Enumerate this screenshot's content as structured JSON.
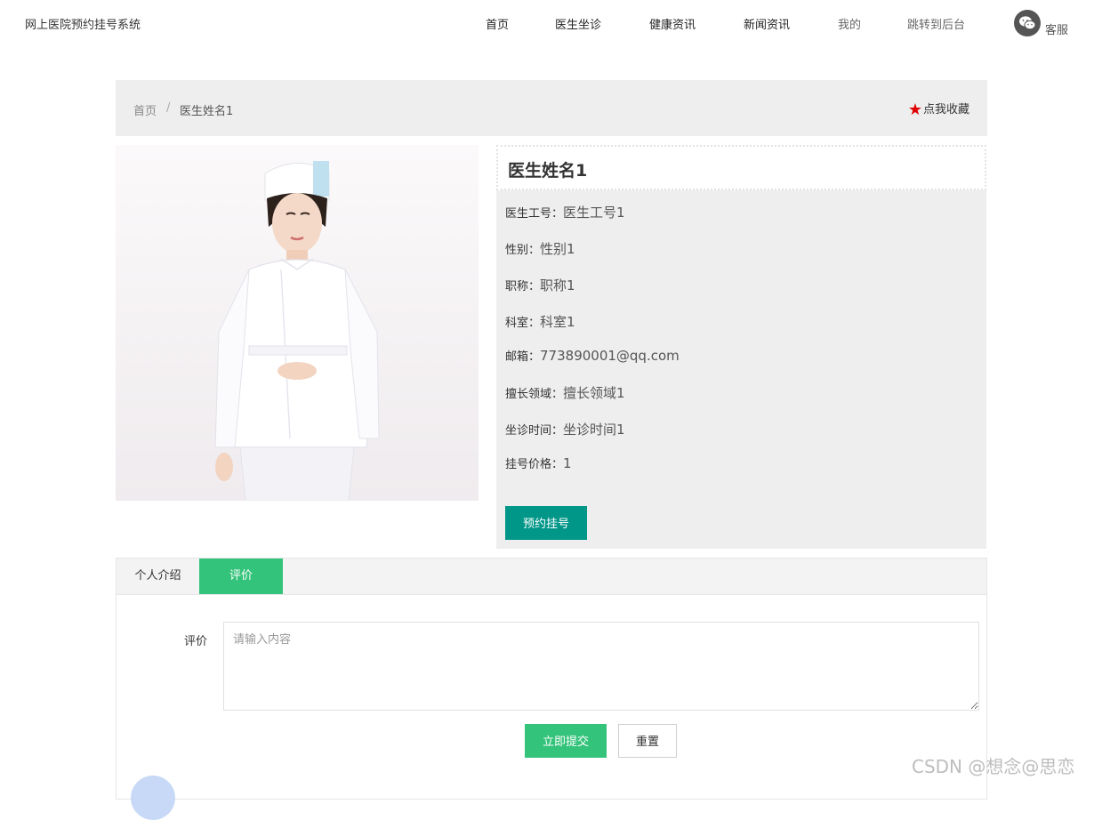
{
  "header": {
    "site_title": "网上医院预约挂号系统",
    "nav": [
      "首页",
      "医生坐诊",
      "健康资讯",
      "新闻资讯",
      "我的",
      "跳转到后台"
    ],
    "service_label": "客服",
    "service_icon": "wechat-icon"
  },
  "breadcrumb": {
    "home": "首页",
    "separator": "/",
    "current": "医生姓名1"
  },
  "favorite": {
    "label": "点我收藏",
    "icon": "star-icon",
    "color": "#e00000"
  },
  "doctor": {
    "name": "医生姓名1",
    "fields": [
      {
        "label": "医生工号：",
        "value": "医生工号1"
      },
      {
        "label": "性别：",
        "value": "性别1"
      },
      {
        "label": "职称：",
        "value": "职称1"
      },
      {
        "label": "科室：",
        "value": "科室1"
      },
      {
        "label": "邮箱：",
        "value": "773890001@qq.com"
      },
      {
        "label": "擅长领域：",
        "value": "擅长领域1"
      },
      {
        "label": "坐诊时间：",
        "value": "坐诊时间1"
      },
      {
        "label": "挂号价格：",
        "value": "1"
      }
    ],
    "book_label": "预约挂号"
  },
  "tabs": {
    "intro": "个人介绍",
    "review": "评价"
  },
  "review_form": {
    "label": "评价",
    "placeholder": "请输入内容",
    "submit": "立即提交",
    "reset": "重置"
  },
  "watermark": "CSDN @想念@思恋",
  "colors": {
    "teal": "#009688",
    "green": "#33c37a",
    "panel": "#eeeeee"
  }
}
